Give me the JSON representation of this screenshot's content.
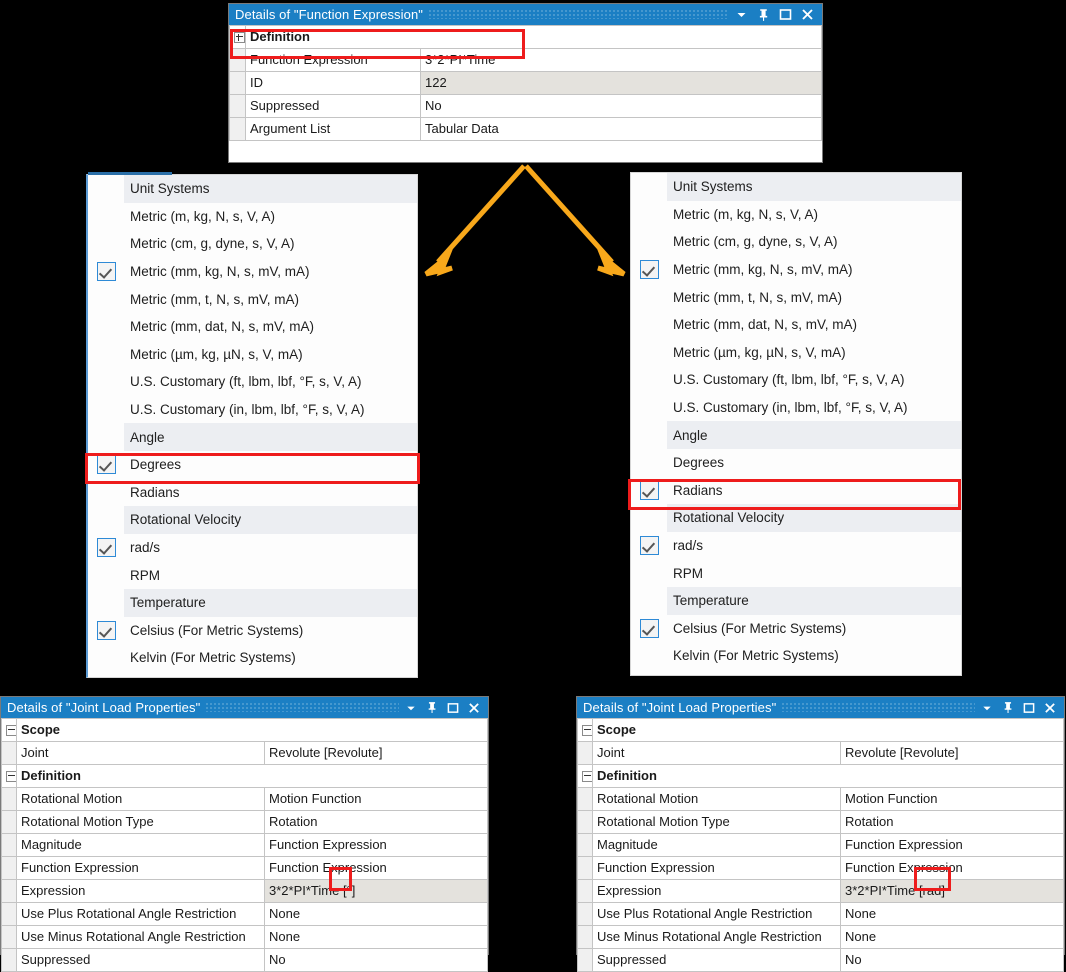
{
  "function_expression_panel": {
    "title": "Details of \"Function Expression\"",
    "titlebar_icons": [
      "chevron-down-icon",
      "pin-icon",
      "maximize-icon",
      "close-icon"
    ],
    "rows": [
      {
        "expander": "plus",
        "group": true,
        "label": "Definition",
        "value": "",
        "readonly": false
      },
      {
        "expander": "",
        "group": false,
        "label": "Function Expression",
        "value": "3*2*PI*Time",
        "readonly": false
      },
      {
        "expander": "",
        "group": false,
        "label": "ID",
        "value": "122",
        "readonly": true
      },
      {
        "expander": "",
        "group": false,
        "label": "Suppressed",
        "value": "No",
        "readonly": false
      },
      {
        "expander": "",
        "group": false,
        "label": "Argument List",
        "value": "Tabular Data",
        "readonly": false
      }
    ]
  },
  "left_menu": {
    "items": [
      {
        "label": "Unit Systems",
        "checked": false,
        "header": true
      },
      {
        "label": "Metric (m, kg, N, s, V, A)",
        "checked": false,
        "header": false
      },
      {
        "label": "Metric (cm, g, dyne, s, V, A)",
        "checked": false,
        "header": false
      },
      {
        "label": "Metric (mm, kg, N, s, mV, mA)",
        "checked": true,
        "header": false
      },
      {
        "label": "Metric (mm, t, N, s, mV, mA)",
        "checked": false,
        "header": false
      },
      {
        "label": "Metric (mm, dat, N, s, mV, mA)",
        "checked": false,
        "header": false
      },
      {
        "label": "Metric (µm, kg, µN, s, V, mA)",
        "checked": false,
        "header": false
      },
      {
        "label": "U.S. Customary (ft, lbm, lbf, °F, s, V, A)",
        "checked": false,
        "header": false
      },
      {
        "label": "U.S. Customary (in, lbm, lbf, °F, s, V, A)",
        "checked": false,
        "header": false
      },
      {
        "label": "Angle",
        "checked": false,
        "header": true
      },
      {
        "label": "Degrees",
        "checked": true,
        "header": false
      },
      {
        "label": "Radians",
        "checked": false,
        "header": false
      },
      {
        "label": "Rotational Velocity",
        "checked": false,
        "header": true
      },
      {
        "label": "rad/s",
        "checked": true,
        "header": false
      },
      {
        "label": "RPM",
        "checked": false,
        "header": false
      },
      {
        "label": "Temperature",
        "checked": false,
        "header": true
      },
      {
        "label": "Celsius (For Metric Systems)",
        "checked": true,
        "header": false
      },
      {
        "label": "Kelvin (For Metric Systems)",
        "checked": false,
        "header": false
      }
    ]
  },
  "right_menu": {
    "items": [
      {
        "label": "Unit Systems",
        "checked": false,
        "header": true
      },
      {
        "label": "Metric (m, kg, N, s, V, A)",
        "checked": false,
        "header": false
      },
      {
        "label": "Metric (cm, g, dyne, s, V, A)",
        "checked": false,
        "header": false
      },
      {
        "label": "Metric (mm, kg, N, s, mV, mA)",
        "checked": true,
        "header": false
      },
      {
        "label": "Metric (mm, t, N, s, mV, mA)",
        "checked": false,
        "header": false
      },
      {
        "label": "Metric (mm, dat, N, s, mV, mA)",
        "checked": false,
        "header": false
      },
      {
        "label": "Metric (µm, kg, µN, s, V, mA)",
        "checked": false,
        "header": false
      },
      {
        "label": "U.S. Customary (ft, lbm, lbf, °F, s, V, A)",
        "checked": false,
        "header": false
      },
      {
        "label": "U.S. Customary (in, lbm, lbf, °F, s, V, A)",
        "checked": false,
        "header": false
      },
      {
        "label": "Angle",
        "checked": false,
        "header": true
      },
      {
        "label": "Degrees",
        "checked": false,
        "header": false
      },
      {
        "label": "Radians",
        "checked": true,
        "header": false
      },
      {
        "label": "Rotational Velocity",
        "checked": false,
        "header": true
      },
      {
        "label": "rad/s",
        "checked": true,
        "header": false
      },
      {
        "label": "RPM",
        "checked": false,
        "header": false
      },
      {
        "label": "Temperature",
        "checked": false,
        "header": true
      },
      {
        "label": "Celsius (For Metric Systems)",
        "checked": true,
        "header": false
      },
      {
        "label": "Kelvin (For Metric Systems)",
        "checked": false,
        "header": false
      }
    ]
  },
  "joint_load_left": {
    "title": "Details of \"Joint Load Properties\"",
    "rows": [
      {
        "expander": "minus",
        "group": true,
        "label": "Scope",
        "value": "",
        "readonly": false
      },
      {
        "expander": "",
        "group": false,
        "label": "Joint",
        "value": "Revolute [Revolute]",
        "readonly": false
      },
      {
        "expander": "minus",
        "group": true,
        "label": "Definition",
        "value": "",
        "readonly": false
      },
      {
        "expander": "",
        "group": false,
        "label": "Rotational Motion",
        "value": "Motion Function",
        "readonly": false
      },
      {
        "expander": "",
        "group": false,
        "label": "Rotational Motion Type",
        "value": "Rotation",
        "readonly": false
      },
      {
        "expander": "",
        "group": false,
        "label": "Magnitude",
        "value": "Function Expression",
        "readonly": false
      },
      {
        "expander": "",
        "group": false,
        "label": "Function Expression",
        "value": "Function Expression",
        "readonly": false
      },
      {
        "expander": "",
        "group": false,
        "label": "Expression",
        "value": "3*2*PI*Time [°]",
        "readonly": true
      },
      {
        "expander": "",
        "group": false,
        "label": "Use Plus Rotational Angle Restriction",
        "value": "None",
        "readonly": false
      },
      {
        "expander": "",
        "group": false,
        "label": "Use Minus Rotational Angle Restriction",
        "value": "None",
        "readonly": false
      },
      {
        "expander": "",
        "group": false,
        "label": "Suppressed",
        "value": "No",
        "readonly": false
      }
    ]
  },
  "joint_load_right": {
    "title": "Details of \"Joint Load Properties\"",
    "rows": [
      {
        "expander": "minus",
        "group": true,
        "label": "Scope",
        "value": "",
        "readonly": false
      },
      {
        "expander": "",
        "group": false,
        "label": "Joint",
        "value": "Revolute [Revolute]",
        "readonly": false
      },
      {
        "expander": "minus",
        "group": true,
        "label": "Definition",
        "value": "",
        "readonly": false
      },
      {
        "expander": "",
        "group": false,
        "label": "Rotational Motion",
        "value": "Motion Function",
        "readonly": false
      },
      {
        "expander": "",
        "group": false,
        "label": "Rotational Motion Type",
        "value": "Rotation",
        "readonly": false
      },
      {
        "expander": "",
        "group": false,
        "label": "Magnitude",
        "value": "Function Expression",
        "readonly": false
      },
      {
        "expander": "",
        "group": false,
        "label": "Function Expression",
        "value": "Function Expression",
        "readonly": false
      },
      {
        "expander": "",
        "group": false,
        "label": "Expression",
        "value": "3*2*PI*Time [rad]",
        "readonly": true
      },
      {
        "expander": "",
        "group": false,
        "label": "Use Plus Rotational Angle Restriction",
        "value": "None",
        "readonly": false
      },
      {
        "expander": "",
        "group": false,
        "label": "Use Minus Rotational Angle Restriction",
        "value": "None",
        "readonly": false
      },
      {
        "expander": "",
        "group": false,
        "label": "Suppressed",
        "value": "No",
        "readonly": false
      }
    ]
  },
  "annotations": {
    "arrow_color": "#f8a81b",
    "highlight_color": "#ee1c1c",
    "highlighted_items": [
      "Definition",
      "Degrees",
      "Radians",
      "[°]",
      "[rad]"
    ]
  }
}
